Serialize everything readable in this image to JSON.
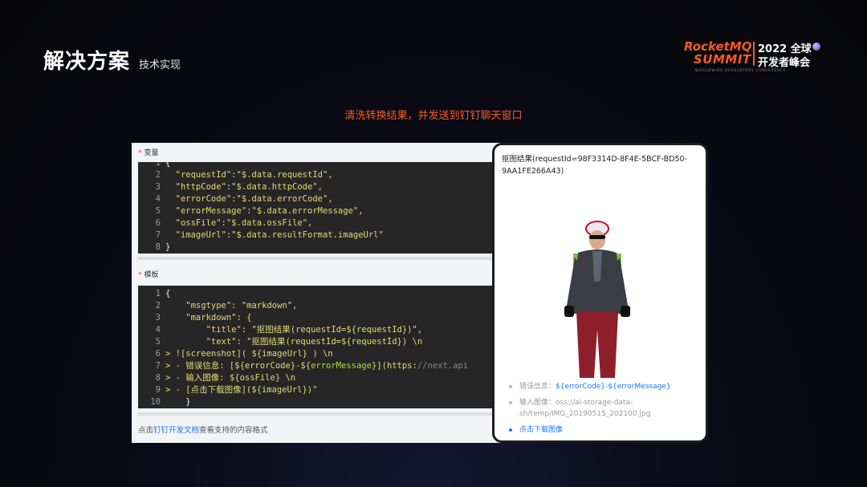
{
  "slide": {
    "title": "解决方案",
    "subtitle": "技术实现",
    "caption": "清洗转换结果，并发送到钉钉聊天窗口"
  },
  "logo": {
    "brand": "RocketMQ",
    "summit": "SUMMIT",
    "year": "2022 全球",
    "event": "开发者峰会",
    "tagline": "WORLDWIDE DEVELOPERS CONFERENCE"
  },
  "variables": {
    "label": "变量",
    "lines": [
      {
        "n": "1",
        "text": "{"
      },
      {
        "n": "2",
        "text": "  \"requestId\":\"$.data.requestId\","
      },
      {
        "n": "3",
        "text": "  \"httpCode\":\"$.data.httpCode\","
      },
      {
        "n": "4",
        "text": "  \"errorCode\":\"$.data.errorCode\","
      },
      {
        "n": "5",
        "text": "  \"errorMessage\":\"$.data.errorMessage\","
      },
      {
        "n": "6",
        "text": "  \"ossFile\":\"$.data.ossFile\","
      },
      {
        "n": "7",
        "text": "  \"imageUrl\":\"$.data.resultFormat.imageUrl\""
      },
      {
        "n": "8",
        "text": "}"
      }
    ]
  },
  "template": {
    "label": "模板",
    "lines": [
      {
        "n": "1",
        "text": "{"
      },
      {
        "n": "2",
        "text": "    \"msgtype\": \"markdown\","
      },
      {
        "n": "3",
        "text": "    \"markdown\": {"
      },
      {
        "n": "4",
        "text": "        \"title\": \"抠图结果(requestId=${requestId})\","
      },
      {
        "n": "5",
        "text": "        \"text\": \"抠图结果(requestId=${requestId}) \\n"
      },
      {
        "n": "6",
        "text": "> ![screenshot]( ${imageUrl} ) \\n"
      },
      {
        "n": "7",
        "pre": "> - 错误信息: [${errorCode}-${",
        "hl": "errorMessage",
        "post": "}](https:",
        "dim": "//next.api"
      },
      {
        "n": "8",
        "text": "> - 输入图像: ${ossFile} \\n"
      },
      {
        "n": "9",
        "text": "> - [点击下载图像](${imageUrl})\""
      },
      {
        "n": "10",
        "text": "    }"
      }
    ]
  },
  "hint": {
    "prefix": "点击",
    "link": "钉钉开发文档",
    "suffix": "查看支持的内容格式"
  },
  "preview": {
    "title": "抠图结果(requestId=98F3314D-8F4E-5BCF-BD50-9AA1FE266A43)",
    "error_label": "错误信息：",
    "error_value": "${errorCode}-${errorMessage}",
    "input_label": "输入图像：",
    "input_value": "oss://ai-storage-data-sh/temp/IMG_20190515_202100.jpg",
    "download_link": "点击下载图像"
  },
  "colors": {
    "accent": "#ff5a1f",
    "link": "#1677ff",
    "code_bg": "#262626"
  }
}
